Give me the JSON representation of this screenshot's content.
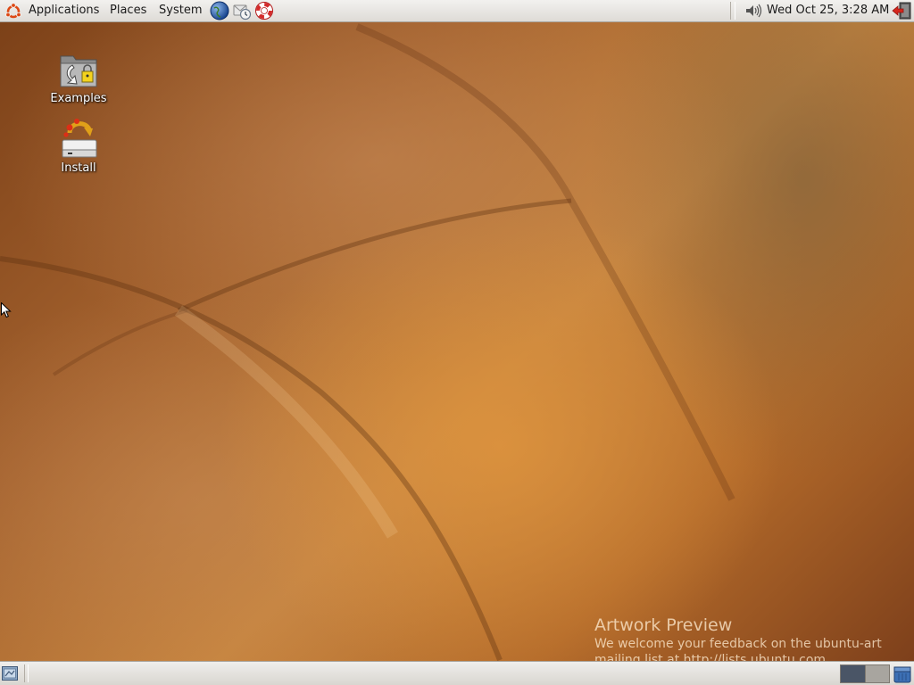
{
  "top_panel": {
    "menus": {
      "applications": "Applications",
      "places": "Places",
      "system": "System"
    },
    "launchers": [
      "web-browser-icon",
      "email-client-icon",
      "help-icon"
    ],
    "clock": "Wed Oct 25,  3:28 AM",
    "tray_icons": [
      "volume-icon",
      "logout-icon"
    ]
  },
  "desktop": {
    "icons": [
      {
        "label": "Examples",
        "icon": "examples-folder-icon"
      },
      {
        "label": "Install",
        "icon": "install-icon"
      }
    ],
    "watermark": {
      "title": "Artwork Preview",
      "line1": "We welcome your feedback on the ubuntu-art",
      "line2": "mailing list at http://lists.ubuntu.com"
    }
  },
  "bottom_panel": {
    "workspaces": [
      "workspace-1",
      "workspace-2"
    ],
    "active_workspace": 1
  },
  "colors": {
    "panel": "#dedbd6",
    "wallpaper_accent": "#c7853f",
    "ubuntu_orange": "#dd4814",
    "active_workspace": "#4a5566"
  }
}
